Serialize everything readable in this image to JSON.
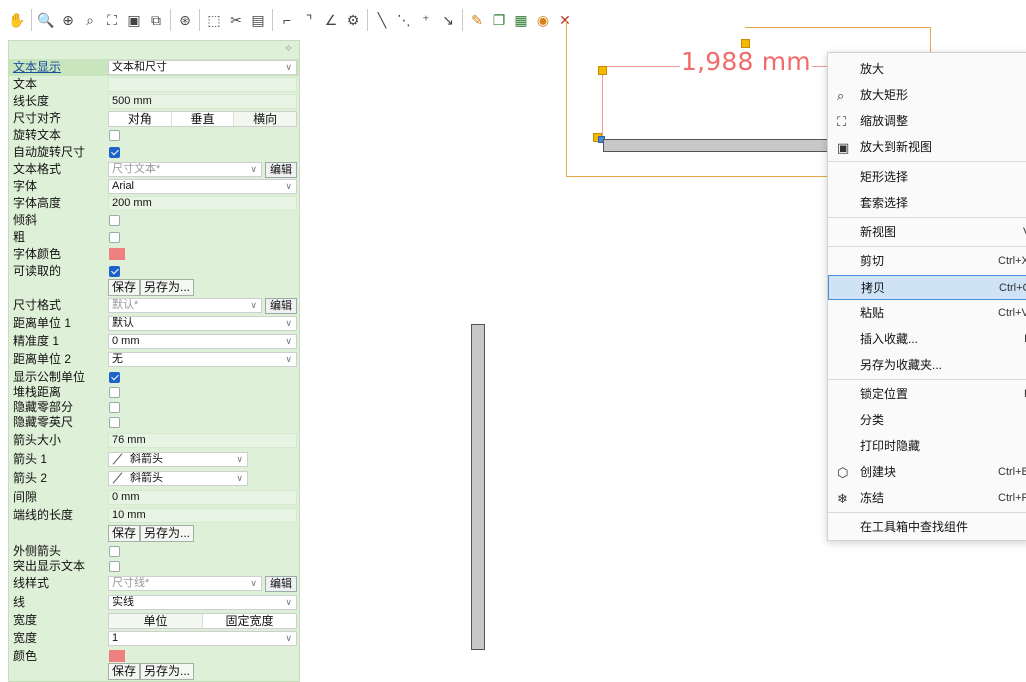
{
  "panel": {
    "rows": {
      "text_display": {
        "label": "文本显示",
        "value": "文本和尺寸"
      },
      "text": {
        "label": "文本",
        "value": ""
      },
      "line_length": {
        "label": "线长度",
        "value": "500 mm"
      },
      "dim_align": {
        "label": "尺寸对齐",
        "options": [
          "对角",
          "垂直",
          "横向"
        ]
      },
      "rotate_text": {
        "label": "旋转文本"
      },
      "auto_rotate": {
        "label": "自动旋转尺寸"
      },
      "text_format": {
        "label": "文本格式",
        "value": "尺寸文本*",
        "edit": "编辑"
      },
      "font": {
        "label": "字体",
        "value": "Arial"
      },
      "font_height": {
        "label": "字体高度",
        "value": "200 mm"
      },
      "italic": {
        "label": "倾斜"
      },
      "bold": {
        "label": "粗"
      },
      "font_color": {
        "label": "字体颜色"
      },
      "readable": {
        "label": "可读取的"
      },
      "save1": {
        "save": "保存",
        "save_as": "另存为..."
      },
      "dim_format": {
        "label": "尺寸格式",
        "value": "默认*",
        "edit": "编辑"
      },
      "dist_unit1": {
        "label": "距离单位 1",
        "value": "默认"
      },
      "precision1": {
        "label": "精准度 1",
        "value": "0 mm"
      },
      "dist_unit2": {
        "label": "距离单位 2",
        "value": "无"
      },
      "show_metric": {
        "label": "显示公制单位"
      },
      "stack_dist": {
        "label": "堆栈距离"
      },
      "hide_zero": {
        "label": "隐藏零部分"
      },
      "hide_zero_ft": {
        "label": "隐藏零英尺"
      },
      "arrow_size": {
        "label": "箭头大小",
        "value": "76 mm"
      },
      "arrow1": {
        "label": "箭头 1",
        "value": "斜箭头"
      },
      "arrow2": {
        "label": "箭头 2",
        "value": "斜箭头"
      },
      "gap": {
        "label": "间隙",
        "value": "0 mm"
      },
      "ext_len": {
        "label": "端线的长度",
        "value": "10 mm"
      },
      "save2": {
        "save": "保存",
        "save_as": "另存为..."
      },
      "outer_arrow": {
        "label": "外侧箭头"
      },
      "highlight_text": {
        "label": "突出显示文本"
      },
      "line_style": {
        "label": "线样式",
        "value": "尺寸线*",
        "edit": "编辑"
      },
      "line": {
        "label": "线",
        "value": "实线"
      },
      "width_mode": {
        "label": "宽度",
        "options": [
          "单位",
          "固定宽度"
        ]
      },
      "width": {
        "label": "宽度",
        "value": "1"
      },
      "color": {
        "label": "颜色"
      },
      "save3": {
        "save": "保存",
        "save_as": "另存为..."
      }
    }
  },
  "canvas": {
    "dimension_text": "1,988 mm"
  },
  "menu": {
    "items": [
      {
        "label": "放大",
        "shortcut": ""
      },
      {
        "label": "放大矩形",
        "shortcut": ""
      },
      {
        "label": "缩放调整",
        "shortcut": ""
      },
      {
        "label": "放大到新视图",
        "shortcut": ""
      },
      {
        "label": "矩形选择",
        "shortcut": ""
      },
      {
        "label": "套索选择",
        "shortcut": ""
      },
      {
        "label": "新视图",
        "shortcut": "V"
      },
      {
        "label": "剪切",
        "shortcut": "Ctrl+X"
      },
      {
        "label": "拷贝",
        "shortcut": "Ctrl+C"
      },
      {
        "label": "粘贴",
        "shortcut": "Ctrl+V"
      },
      {
        "label": "插入收藏...",
        "shortcut": "I"
      },
      {
        "label": "另存为收藏夹...",
        "shortcut": ""
      },
      {
        "label": "锁定位置",
        "shortcut": "L"
      },
      {
        "label": "分类",
        "shortcut": ""
      },
      {
        "label": "打印时隐藏",
        "shortcut": ""
      },
      {
        "label": "创建块",
        "shortcut": "Ctrl+B"
      },
      {
        "label": "冻结",
        "shortcut": "Ctrl+F"
      },
      {
        "label": "在工具箱中查找组件",
        "shortcut": ""
      }
    ]
  }
}
